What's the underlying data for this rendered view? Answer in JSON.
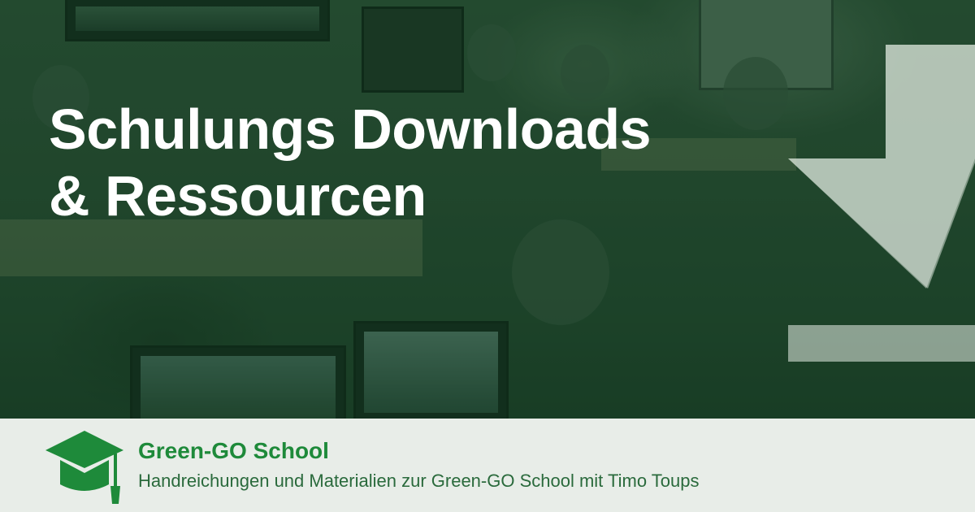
{
  "hero": {
    "title_line1": "Schulungs Downloads",
    "title_line2": "& Ressourcen",
    "download_icon": "download-arrow-icon"
  },
  "footer": {
    "brand": "Green-GO School",
    "tagline": "Handreichungen und Materialien zur Green-GO School mit Timo Toups",
    "logo_icon": "graduation-cap-icon"
  },
  "colors": {
    "overlay_green": "#16462a",
    "brand_green": "#1e8a3a",
    "footer_bg": "#e8ede8",
    "title_white": "#ffffff"
  }
}
